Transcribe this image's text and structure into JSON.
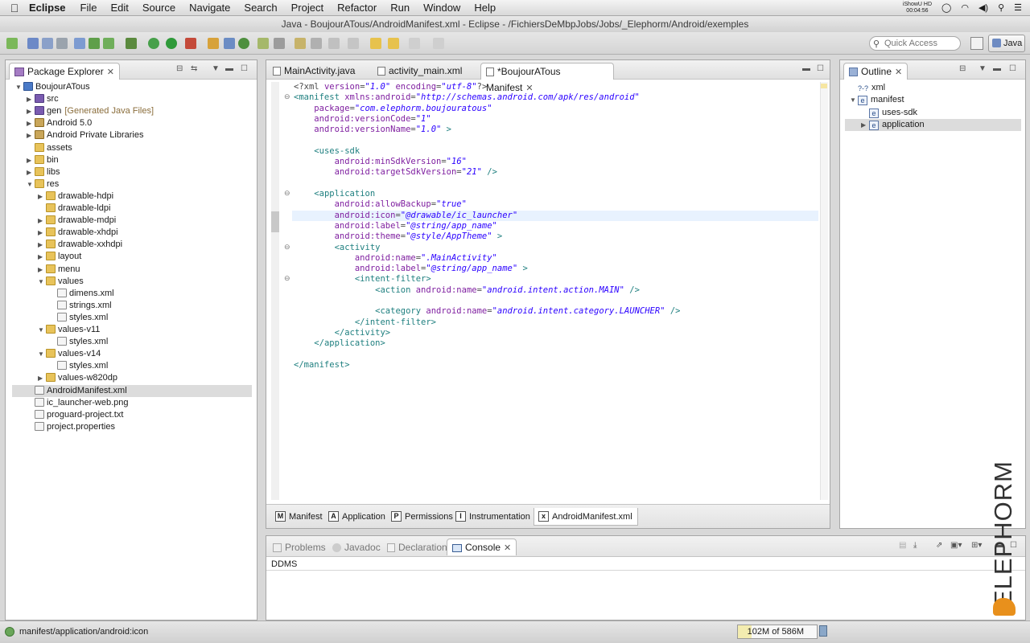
{
  "menubar": {
    "app": "Eclipse",
    "items": [
      "File",
      "Edit",
      "Source",
      "Navigate",
      "Search",
      "Project",
      "Refactor",
      "Run",
      "Window",
      "Help"
    ],
    "recorder": [
      "iShowU HD",
      "00:04:56"
    ]
  },
  "window": {
    "title": "Java - BoujourATous/AndroidManifest.xml - Eclipse - /FichiersDeMbpJobs/Jobs/_Elephorm/Android/exemples"
  },
  "toolbar": {
    "quick_access_placeholder": "Quick Access",
    "perspective": "Java"
  },
  "package_explorer": {
    "tab": "Package Explorer",
    "tree": [
      {
        "depth": 0,
        "twisty": "▼",
        "icon": "project",
        "label": "BoujourATous"
      },
      {
        "depth": 1,
        "twisty": "▶",
        "icon": "package",
        "label": "src"
      },
      {
        "depth": 1,
        "twisty": "▶",
        "icon": "package",
        "label": "gen",
        "extra": "[Generated Java Files]"
      },
      {
        "depth": 1,
        "twisty": "▶",
        "icon": "library",
        "label": "Android 5.0"
      },
      {
        "depth": 1,
        "twisty": "▶",
        "icon": "library",
        "label": "Android Private Libraries"
      },
      {
        "depth": 1,
        "twisty": "",
        "icon": "folder",
        "label": "assets"
      },
      {
        "depth": 1,
        "twisty": "▶",
        "icon": "folder",
        "label": "bin"
      },
      {
        "depth": 1,
        "twisty": "▶",
        "icon": "folder",
        "label": "libs"
      },
      {
        "depth": 1,
        "twisty": "▼",
        "icon": "folder",
        "label": "res"
      },
      {
        "depth": 2,
        "twisty": "▶",
        "icon": "folder",
        "label": "drawable-hdpi"
      },
      {
        "depth": 2,
        "twisty": "",
        "icon": "folder",
        "label": "drawable-ldpi"
      },
      {
        "depth": 2,
        "twisty": "▶",
        "icon": "folder",
        "label": "drawable-mdpi"
      },
      {
        "depth": 2,
        "twisty": "▶",
        "icon": "folder",
        "label": "drawable-xhdpi"
      },
      {
        "depth": 2,
        "twisty": "▶",
        "icon": "folder",
        "label": "drawable-xxhdpi"
      },
      {
        "depth": 2,
        "twisty": "▶",
        "icon": "folder",
        "label": "layout"
      },
      {
        "depth": 2,
        "twisty": "▶",
        "icon": "folder",
        "label": "menu"
      },
      {
        "depth": 2,
        "twisty": "▼",
        "icon": "folder",
        "label": "values"
      },
      {
        "depth": 3,
        "twisty": "",
        "icon": "file",
        "label": "dimens.xml"
      },
      {
        "depth": 3,
        "twisty": "",
        "icon": "file",
        "label": "strings.xml"
      },
      {
        "depth": 3,
        "twisty": "",
        "icon": "file",
        "label": "styles.xml"
      },
      {
        "depth": 2,
        "twisty": "▼",
        "icon": "folder",
        "label": "values-v11"
      },
      {
        "depth": 3,
        "twisty": "",
        "icon": "file",
        "label": "styles.xml"
      },
      {
        "depth": 2,
        "twisty": "▼",
        "icon": "folder",
        "label": "values-v14"
      },
      {
        "depth": 3,
        "twisty": "",
        "icon": "file",
        "label": "styles.xml"
      },
      {
        "depth": 2,
        "twisty": "▶",
        "icon": "folder",
        "label": "values-w820dp"
      },
      {
        "depth": 1,
        "twisty": "",
        "icon": "file",
        "label": "AndroidManifest.xml",
        "selected": true
      },
      {
        "depth": 1,
        "twisty": "",
        "icon": "file",
        "label": "ic_launcher-web.png"
      },
      {
        "depth": 1,
        "twisty": "",
        "icon": "file",
        "label": "proguard-project.txt"
      },
      {
        "depth": 1,
        "twisty": "",
        "icon": "file",
        "label": "project.properties"
      }
    ]
  },
  "editor": {
    "tabs": [
      "MainActivity.java",
      "activity_main.xml",
      "*BoujourATous Manifest"
    ],
    "active_tab": 2,
    "code": [
      [
        [
          "pi",
          "<?xml "
        ],
        [
          "attr",
          "version"
        ],
        [
          "pi",
          "="
        ],
        [
          "val",
          "\"1.0\""
        ],
        [
          "pi",
          " "
        ],
        [
          "attr",
          "encoding"
        ],
        [
          "pi",
          "="
        ],
        [
          "val",
          "\"utf-8\""
        ],
        [
          "pi",
          "?>"
        ]
      ],
      [
        [
          "tag",
          "<manifest "
        ],
        [
          "attr",
          "xmlns:android"
        ],
        [
          "pi",
          "="
        ],
        [
          "val",
          "\"http://schemas.android.com/apk/res/android\""
        ]
      ],
      [
        [
          "pi",
          "    "
        ],
        [
          "attr",
          "package"
        ],
        [
          "pi",
          "="
        ],
        [
          "val",
          "\"com.elephorm.boujouratous\""
        ]
      ],
      [
        [
          "pi",
          "    "
        ],
        [
          "attr",
          "android:versionCode"
        ],
        [
          "pi",
          "="
        ],
        [
          "val",
          "\"1\""
        ]
      ],
      [
        [
          "pi",
          "    "
        ],
        [
          "attr",
          "android:versionName"
        ],
        [
          "pi",
          "="
        ],
        [
          "val",
          "\"1.0\""
        ],
        [
          "tag",
          " >"
        ]
      ],
      [],
      [
        [
          "pi",
          "    "
        ],
        [
          "tag",
          "<uses-sdk"
        ]
      ],
      [
        [
          "pi",
          "        "
        ],
        [
          "attr",
          "android:minSdkVersion"
        ],
        [
          "pi",
          "="
        ],
        [
          "val",
          "\"16\""
        ]
      ],
      [
        [
          "pi",
          "        "
        ],
        [
          "attr",
          "android:targetSdkVersion"
        ],
        [
          "pi",
          "="
        ],
        [
          "val",
          "\"21\""
        ],
        [
          "tag",
          " />"
        ]
      ],
      [],
      [
        [
          "pi",
          "    "
        ],
        [
          "tag",
          "<application"
        ]
      ],
      [
        [
          "pi",
          "        "
        ],
        [
          "attr",
          "android:allowBackup"
        ],
        [
          "pi",
          "="
        ],
        [
          "val",
          "\"true\""
        ]
      ],
      [
        [
          "pi",
          "        "
        ],
        [
          "attr",
          "android:icon"
        ],
        [
          "pi",
          "="
        ],
        [
          "val",
          "\"@drawable/ic_launcher\""
        ]
      ],
      [
        [
          "pi",
          "        "
        ],
        [
          "attr",
          "android:label"
        ],
        [
          "pi",
          "="
        ],
        [
          "val",
          "\"@string/app_name\""
        ]
      ],
      [
        [
          "pi",
          "        "
        ],
        [
          "attr",
          "android:theme"
        ],
        [
          "pi",
          "="
        ],
        [
          "val",
          "\"@style/AppTheme\""
        ],
        [
          "tag",
          " >"
        ]
      ],
      [
        [
          "pi",
          "        "
        ],
        [
          "tag",
          "<activity"
        ]
      ],
      [
        [
          "pi",
          "            "
        ],
        [
          "attr",
          "android:name"
        ],
        [
          "pi",
          "="
        ],
        [
          "val",
          "\".MainActivity\""
        ]
      ],
      [
        [
          "pi",
          "            "
        ],
        [
          "attr",
          "android:label"
        ],
        [
          "pi",
          "="
        ],
        [
          "val",
          "\"@string/app_name\""
        ],
        [
          "tag",
          " >"
        ]
      ],
      [
        [
          "pi",
          "            "
        ],
        [
          "tag",
          "<intent-filter>"
        ]
      ],
      [
        [
          "pi",
          "                "
        ],
        [
          "tag",
          "<action "
        ],
        [
          "attr",
          "android:name"
        ],
        [
          "pi",
          "="
        ],
        [
          "val",
          "\"android.intent.action.MAIN\""
        ],
        [
          "tag",
          " />"
        ]
      ],
      [],
      [
        [
          "pi",
          "                "
        ],
        [
          "tag",
          "<category "
        ],
        [
          "attr",
          "android:name"
        ],
        [
          "pi",
          "="
        ],
        [
          "val",
          "\"android.intent.category.LAUNCHER\""
        ],
        [
          "tag",
          " />"
        ]
      ],
      [
        [
          "pi",
          "            "
        ],
        [
          "tag",
          "</intent-filter>"
        ]
      ],
      [
        [
          "pi",
          "        "
        ],
        [
          "tag",
          "</activity>"
        ]
      ],
      [
        [
          "pi",
          "    "
        ],
        [
          "tag",
          "</application>"
        ]
      ],
      [],
      [
        [
          "tag",
          "</manifest>"
        ]
      ]
    ],
    "fold_lines": [
      1,
      10,
      15,
      18
    ],
    "current_line": 12,
    "bottom_tabs": [
      {
        "icon": "M",
        "label": "Manifest"
      },
      {
        "icon": "A",
        "label": "Application"
      },
      {
        "icon": "P",
        "label": "Permissions"
      },
      {
        "icon": "I",
        "label": "Instrumentation"
      },
      {
        "icon": "x",
        "label": "AndroidManifest.xml"
      }
    ],
    "active_bottom_tab": 4
  },
  "outline": {
    "tab": "Outline",
    "tree": [
      {
        "depth": 0,
        "twisty": "",
        "icon": "?-?",
        "label": "xml"
      },
      {
        "depth": 0,
        "twisty": "▼",
        "icon": "e",
        "label": "manifest"
      },
      {
        "depth": 1,
        "twisty": "",
        "icon": "e",
        "label": "uses-sdk"
      },
      {
        "depth": 1,
        "twisty": "▶",
        "icon": "e",
        "label": "application",
        "selected": true
      }
    ]
  },
  "bottom_views": {
    "tabs": [
      "Problems",
      "Javadoc",
      "Declaration",
      "Console"
    ],
    "active_tab": 3,
    "console_text": "DDMS"
  },
  "status": {
    "path": "manifest/application/android:icon",
    "heap": "102M of 586M",
    "heap_fraction": 0.174
  },
  "watermark": "ELEPHORM"
}
